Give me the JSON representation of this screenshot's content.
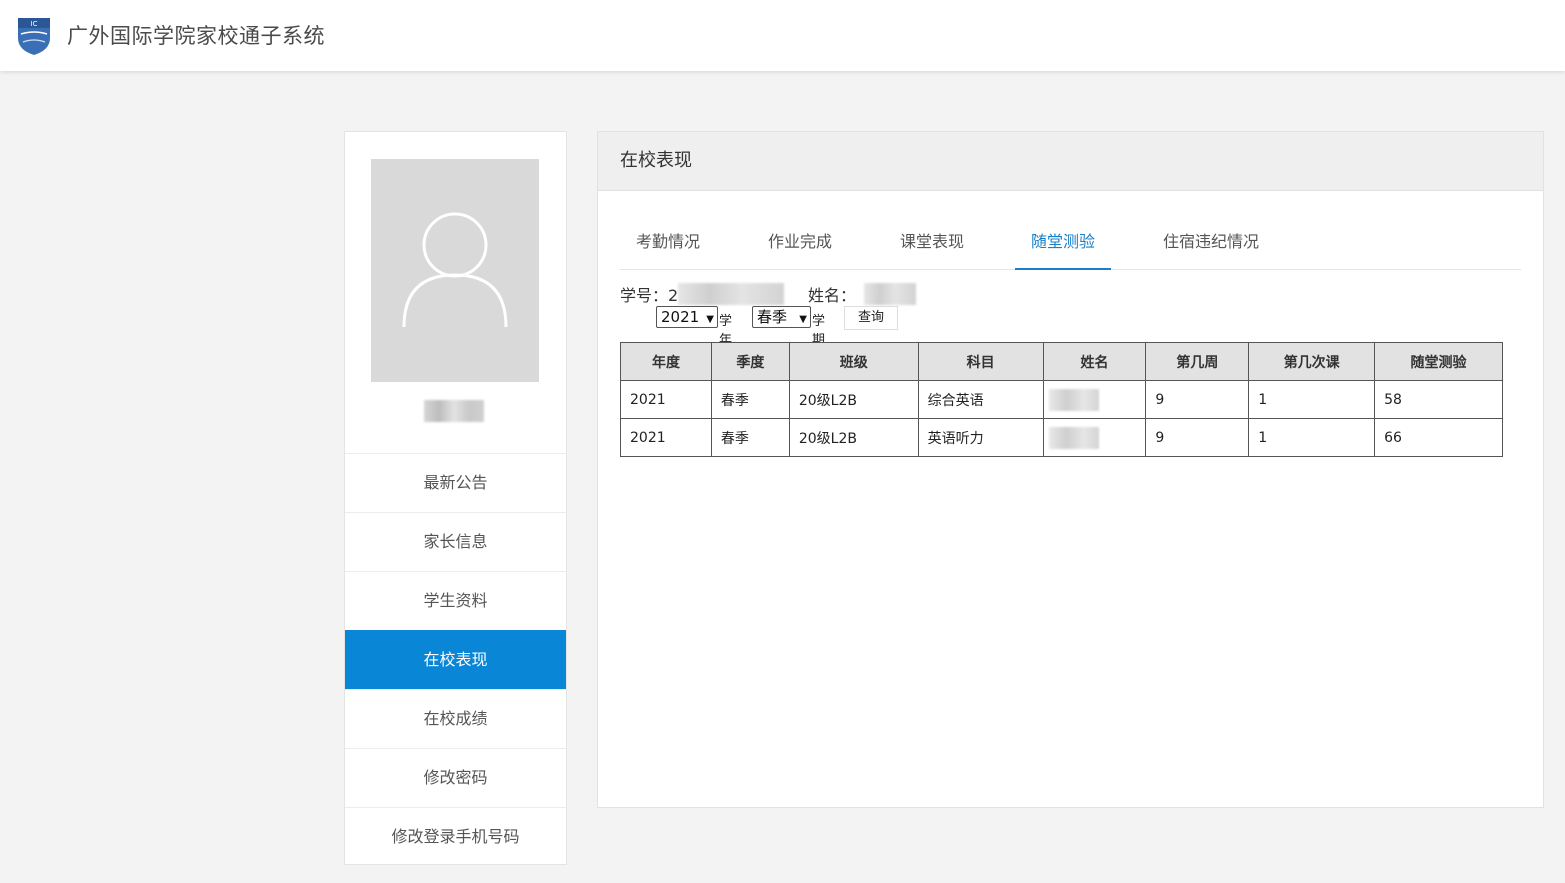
{
  "app": {
    "title": "广外国际学院家校通子系统",
    "logo_text": "IC"
  },
  "sidebar": {
    "menu": [
      {
        "label": "最新公告",
        "active": false
      },
      {
        "label": "家长信息",
        "active": false
      },
      {
        "label": "学生资料",
        "active": false
      },
      {
        "label": "在校表现",
        "active": true
      },
      {
        "label": "在校成绩",
        "active": false
      },
      {
        "label": "修改密码",
        "active": false
      },
      {
        "label": "修改登录手机号码",
        "active": false
      }
    ]
  },
  "panel": {
    "title": "在校表现",
    "tabs": [
      {
        "label": "考勤情况",
        "active": false
      },
      {
        "label": "作业完成",
        "active": false
      },
      {
        "label": "课堂表现",
        "active": false
      },
      {
        "label": "随堂测验",
        "active": true
      },
      {
        "label": "住宿违纪情况",
        "active": false
      }
    ],
    "student_id_label": "学号：2",
    "name_label": "姓名："
  },
  "filter": {
    "year_value": "2021",
    "year_suffix": "学年",
    "term_value": "春季",
    "term_suffix": "学期",
    "query_label": "查询"
  },
  "table": {
    "headers": [
      "年度",
      "季度",
      "班级",
      "科目",
      "姓名",
      "第几周",
      "第几次课",
      "随堂测验"
    ],
    "rows": [
      [
        "2021",
        "春季",
        "20级L2B",
        "综合英语",
        "",
        "9",
        "1",
        "58"
      ],
      [
        "2021",
        "春季",
        "20级L2B",
        "英语听力",
        "",
        "9",
        "1",
        "66"
      ]
    ]
  },
  "colors": {
    "accent": "#0a86d6",
    "tab_active": "#1a7fc9"
  }
}
